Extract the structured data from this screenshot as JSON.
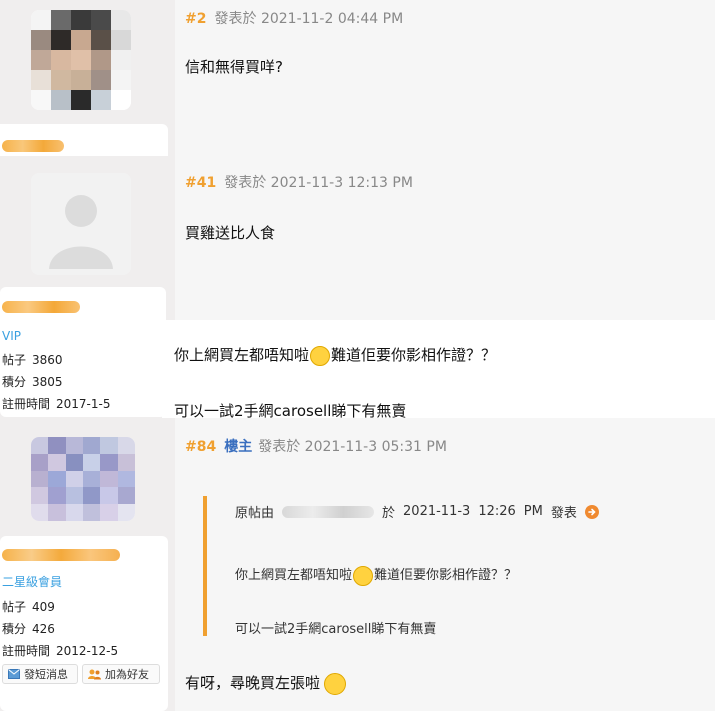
{
  "posts": [
    {
      "number": "#2",
      "posted_label": "發表於",
      "date": "2021-11-2 04:44 PM",
      "content": "信和無得買咩?"
    },
    {
      "number": "#41",
      "posted_label": "發表於",
      "date": "2021-11-3 12:13 PM",
      "content": "買雞送比人食"
    },
    {
      "number": "#84",
      "owner_label": "樓主",
      "posted_label": "發表於",
      "date": "2021-11-3 05:31 PM",
      "quote": {
        "prefix": "原帖由",
        "at_label": "於",
        "date": "2021-11-3",
        "time": "12:26",
        "ampm": "PM",
        "posted_label": "發表",
        "line1_before": "你上網買左都唔知啦",
        "line1_after": "難道佢要你影相作證？？",
        "line2": "可以一試2手網carosell睇下有無賣"
      },
      "content": "有呀，尋晚買左張啦"
    }
  ],
  "interleaved_reply": {
    "line1_before": "你上網買左都唔知啦",
    "line1_after": "難道佢要你影相作證？？",
    "line2": "可以一試2手網carosell睇下有無賣"
  },
  "users": [
    {
      "rank": "VIP",
      "posts_label": "帖子",
      "posts": "3860",
      "points_label": "積分",
      "points": "3805",
      "reg_label": "註冊時間",
      "reg_date": "2017-1-5"
    },
    {
      "rank": "二星級會員",
      "posts_label": "帖子",
      "posts": "409",
      "points_label": "積分",
      "points": "426",
      "reg_label": "註冊時間",
      "reg_date": "2012-12-5",
      "actions": {
        "message": "發短消息",
        "add_friend": "加為好友"
      }
    }
  ],
  "colors": {
    "post_number": "#f0a030",
    "owner_tag": "#3a6fbf",
    "rank": "#3aa0e0",
    "quote_bar": "#f0a030"
  }
}
